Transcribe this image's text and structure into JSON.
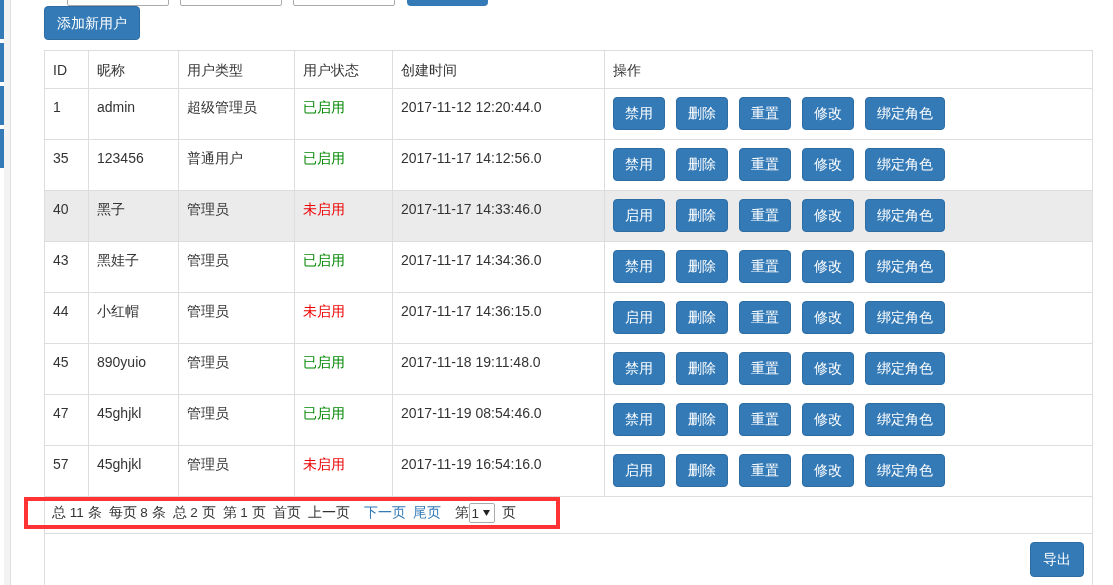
{
  "add_button": "添加新用户",
  "table": {
    "columns": [
      "ID",
      "昵称",
      "用户类型",
      "用户状态",
      "创建时间",
      "操作"
    ],
    "rows": [
      {
        "id": "1",
        "nickname": "admin",
        "type": "超级管理员",
        "status": "已启用",
        "enabled": true,
        "created": "2017-11-12 12:20:44.0",
        "highlighted": false,
        "actions": [
          "禁用",
          "删除",
          "重置",
          "修改",
          "绑定角色"
        ]
      },
      {
        "id": "35",
        "nickname": "123456",
        "type": "普通用户",
        "status": "已启用",
        "enabled": true,
        "created": "2017-11-17 14:12:56.0",
        "highlighted": false,
        "actions": [
          "禁用",
          "删除",
          "重置",
          "修改",
          "绑定角色"
        ]
      },
      {
        "id": "40",
        "nickname": "黑子",
        "type": "管理员",
        "status": "未启用",
        "enabled": false,
        "created": "2017-11-17 14:33:46.0",
        "highlighted": true,
        "actions": [
          "启用",
          "删除",
          "重置",
          "修改",
          "绑定角色"
        ]
      },
      {
        "id": "43",
        "nickname": "黑娃子",
        "type": "管理员",
        "status": "已启用",
        "enabled": true,
        "created": "2017-11-17 14:34:36.0",
        "highlighted": false,
        "actions": [
          "禁用",
          "删除",
          "重置",
          "修改",
          "绑定角色"
        ]
      },
      {
        "id": "44",
        "nickname": "小红帽",
        "type": "管理员",
        "status": "未启用",
        "enabled": false,
        "created": "2017-11-17 14:36:15.0",
        "highlighted": false,
        "actions": [
          "启用",
          "删除",
          "重置",
          "修改",
          "绑定角色"
        ]
      },
      {
        "id": "45",
        "nickname": "890yuio",
        "type": "管理员",
        "status": "已启用",
        "enabled": true,
        "created": "2017-11-18 19:11:48.0",
        "highlighted": false,
        "actions": [
          "禁用",
          "删除",
          "重置",
          "修改",
          "绑定角色"
        ]
      },
      {
        "id": "47",
        "nickname": "45ghjkl",
        "type": "管理员",
        "status": "已启用",
        "enabled": true,
        "created": "2017-11-19 08:54:46.0",
        "highlighted": false,
        "actions": [
          "禁用",
          "删除",
          "重置",
          "修改",
          "绑定角色"
        ]
      },
      {
        "id": "57",
        "nickname": "45ghjkl",
        "type": "管理员",
        "status": "未启用",
        "enabled": false,
        "created": "2017-11-19 16:54:16.0",
        "highlighted": false,
        "actions": [
          "启用",
          "删除",
          "重置",
          "修改",
          "绑定角色"
        ]
      }
    ]
  },
  "pagination": {
    "items": [
      {
        "kind": "text",
        "text": "总 11 条"
      },
      {
        "kind": "text",
        "text": "每页 8 条"
      },
      {
        "kind": "text",
        "text": "总 2 页"
      },
      {
        "kind": "text",
        "text": "第 1 页"
      },
      {
        "kind": "text",
        "text": "首页"
      },
      {
        "kind": "text",
        "text": "上一页"
      },
      {
        "kind": "link",
        "text": "下一页"
      },
      {
        "kind": "link",
        "text": "尾页"
      },
      {
        "kind": "text",
        "text": "第"
      },
      {
        "kind": "select",
        "text": "1"
      },
      {
        "kind": "text",
        "text": "页"
      }
    ],
    "highlighted": true
  },
  "export_button": "导出"
}
